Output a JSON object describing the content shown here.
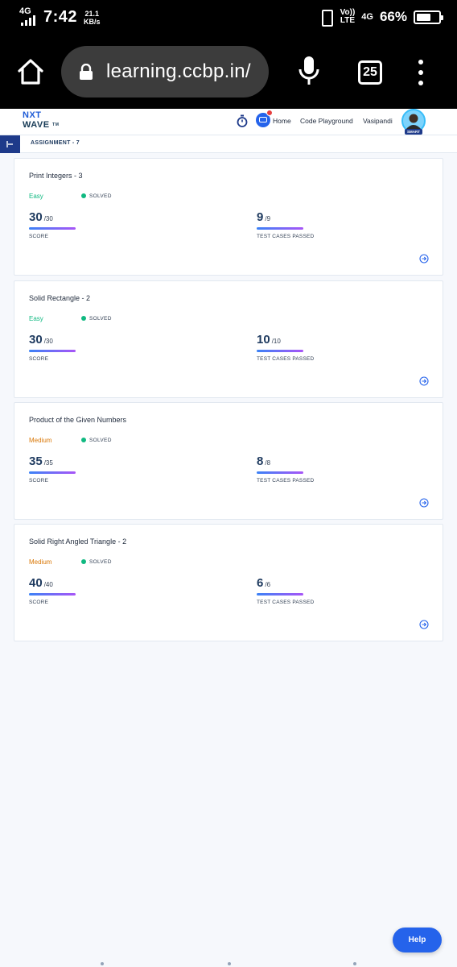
{
  "status_bar": {
    "network_type": "4G",
    "time": "7:42",
    "net_speed": "21.1",
    "net_speed_unit": "KB/s",
    "volte_top": "Vo))",
    "volte_bottom": "LTE",
    "network_type_2": "4G",
    "battery_percent": "66%",
    "battery_level": 0.66
  },
  "browser": {
    "url": "learning.ccbp.in/",
    "tab_count": "25"
  },
  "header": {
    "logo_line1": "NXT",
    "logo_line2": "WAVE",
    "logo_tm": "TM",
    "nav_home": "Home",
    "nav_code_playground": "Code Playground",
    "user_name": "Vasipandi",
    "avatar_badge": "SMART"
  },
  "breadcrumb": {
    "label": "ASSIGNMENT - 7"
  },
  "questions": [
    {
      "title": "Print Integers - 3",
      "difficulty": "Easy",
      "difficulty_color": "#10b981",
      "status": "SOLVED",
      "score": "30",
      "score_max": "/30",
      "score_label": "SCORE",
      "tests": "9",
      "tests_max": "/9",
      "tests_label": "TEST CASES PASSED"
    },
    {
      "title": "Solid Rectangle - 2",
      "difficulty": "Easy",
      "difficulty_color": "#10b981",
      "status": "SOLVED",
      "score": "30",
      "score_max": "/30",
      "score_label": "SCORE",
      "tests": "10",
      "tests_max": "/10",
      "tests_label": "TEST CASES PASSED"
    },
    {
      "title": "Product of the Given Numbers",
      "difficulty": "Medium",
      "difficulty_color": "#d97706",
      "status": "SOLVED",
      "score": "35",
      "score_max": "/35",
      "score_label": "SCORE",
      "tests": "8",
      "tests_max": "/8",
      "tests_label": "TEST CASES PASSED"
    },
    {
      "title": "Solid Right Angled Triangle - 2",
      "difficulty": "Medium",
      "difficulty_color": "#d97706",
      "status": "SOLVED",
      "score": "40",
      "score_max": "/40",
      "score_label": "SCORE",
      "tests": "6",
      "tests_max": "/6",
      "tests_label": "TEST CASES PASSED"
    }
  ],
  "help_button": {
    "label": "Help"
  },
  "icons": {
    "home": "home-icon",
    "lock": "lock-icon",
    "mic": "mic-icon",
    "menu": "more-vertical-icon",
    "timer": "stopwatch-icon",
    "chat": "chat-icon",
    "sidebar": "sidebar-toggle-icon",
    "goto": "arrow-circle-right-icon"
  },
  "colors": {
    "accent": "#2563eb",
    "easy": "#10b981",
    "medium": "#d97706",
    "solved_dot": "#10b981"
  }
}
